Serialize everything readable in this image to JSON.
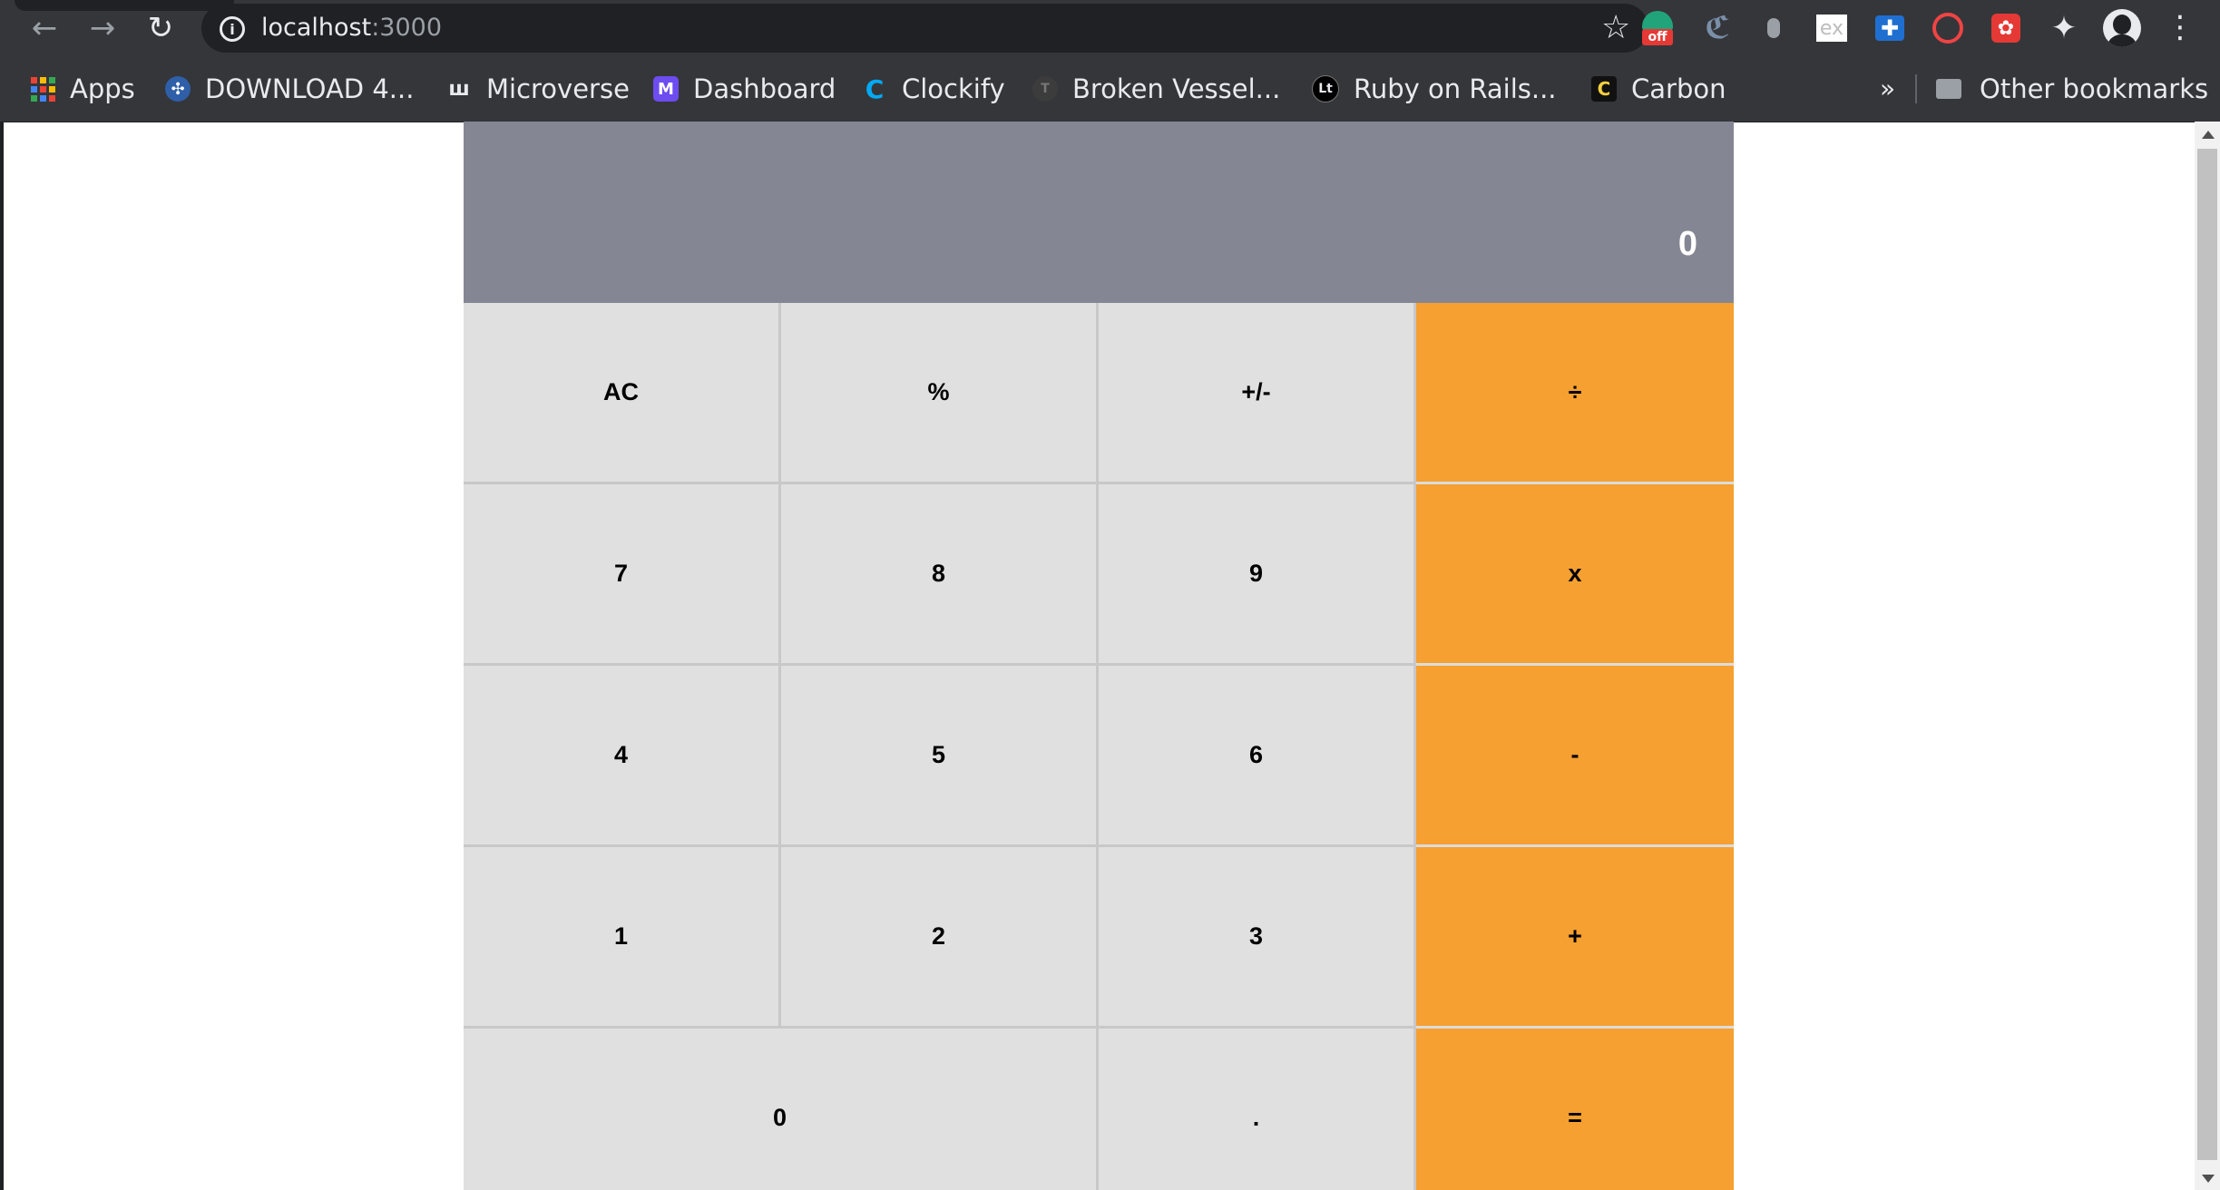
{
  "browser": {
    "url_host": "localhost",
    "url_port": ":3000",
    "nav_icons": [
      "back-arrow-icon",
      "forward-arrow-icon",
      "reload-icon"
    ],
    "extension_icons": [
      "honey-icon",
      "clockify-icon",
      "mouse-icon",
      "ex-icon",
      "cross-icon",
      "spiral-icon",
      "paw-icon",
      "puzzle-icon"
    ],
    "honey_badge": "off"
  },
  "bookmarks": {
    "items": [
      {
        "label": "Apps",
        "icon": "apps-grid-icon"
      },
      {
        "label": "DOWNLOAD 4...",
        "icon": "film-reel-icon"
      },
      {
        "label": "Microverse",
        "icon": "microverse-icon"
      },
      {
        "label": "Dashboard",
        "icon": "dashboard-icon"
      },
      {
        "label": "Clockify",
        "icon": "clockify-icon"
      },
      {
        "label": "Broken Vessel...",
        "icon": "t-circle-icon"
      },
      {
        "label": "Ruby on Rails...",
        "icon": "lt-circle-icon"
      },
      {
        "label": "Carbon",
        "icon": "carbon-icon"
      }
    ],
    "overflow": "»",
    "other": "Other bookmarks"
  },
  "calculator": {
    "display": "0",
    "colors": {
      "display_bg": "#858694",
      "key_bg": "#e0e0e0",
      "operator_bg": "#f5a030"
    },
    "keys": {
      "ac": "AC",
      "percent": "%",
      "sign": "+/-",
      "divide": "÷",
      "seven": "7",
      "eight": "8",
      "nine": "9",
      "multiply": "x",
      "four": "4",
      "five": "5",
      "six": "6",
      "minus": "-",
      "one": "1",
      "two": "2",
      "three": "3",
      "plus": "+",
      "zero": "0",
      "decimal": ".",
      "equals": "="
    }
  }
}
